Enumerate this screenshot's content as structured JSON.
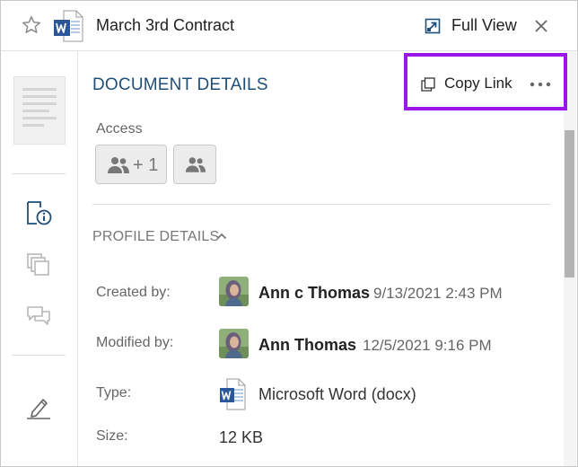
{
  "header": {
    "title": "March 3rd Contract",
    "full_view_label": "Full View"
  },
  "main": {
    "section_title": "DOCUMENT DETAILS",
    "copy_link_label": "Copy Link",
    "access": {
      "label": "Access",
      "shared_count": "+ 1"
    },
    "profile": {
      "title": "PROFILE DETAILS",
      "fields": [
        {
          "label": "Created by:",
          "name": "Ann c Thomas",
          "timestamp": "9/13/2021 2:43 PM"
        },
        {
          "label": "Modified by:",
          "name": "Ann Thomas",
          "timestamp": "12/5/2021 9:16 PM"
        },
        {
          "label": "Type:",
          "value": "Microsoft Word (docx)"
        },
        {
          "label": "Size:",
          "value": "12 KB"
        }
      ]
    }
  },
  "icons": {
    "favorite": "star-icon",
    "file_type": "word-icon",
    "full_view": "expand-icon",
    "close": "close-icon",
    "details_tab": "document-info-icon",
    "versions_tab": "versions-icon",
    "comments_tab": "comments-icon",
    "sign_tab": "signature-pen-icon",
    "copy": "copy-icon",
    "more": "more-options-icon",
    "people": "people-icon"
  },
  "colors": {
    "section_title": "#1f4e79",
    "highlight": "#9b16e8",
    "word_blue": "#2b579a",
    "rail_icon": "#1f4e79"
  }
}
